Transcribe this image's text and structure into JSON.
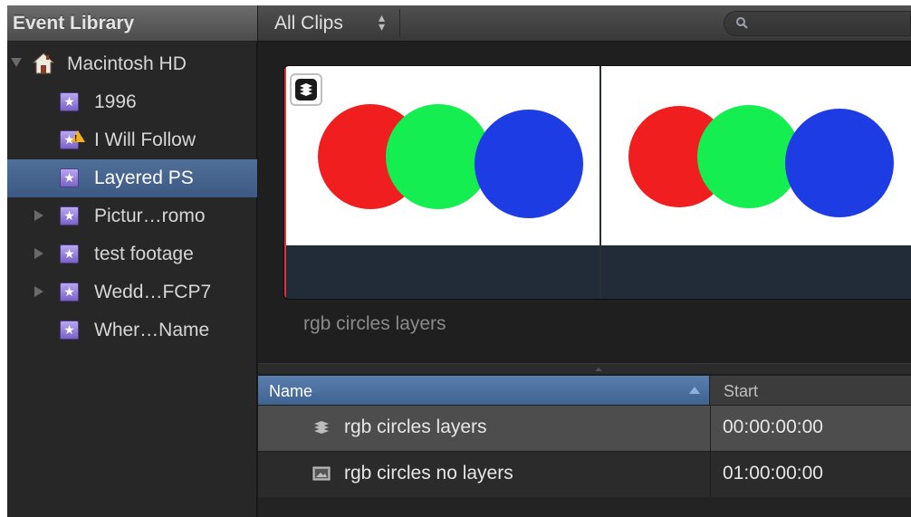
{
  "sidebar": {
    "title": "Event Library",
    "root": {
      "label": "Macintosh HD",
      "icon": "hard-drive-house-icon",
      "expanded": true
    },
    "events": [
      {
        "label": "1996",
        "icon": "event-star-icon",
        "has_children": false,
        "selected": false,
        "warning": false
      },
      {
        "label": "I Will Follow",
        "icon": "event-star-warning-icon",
        "has_children": false,
        "selected": false,
        "warning": true
      },
      {
        "label": "Layered PS",
        "icon": "event-star-icon",
        "has_children": false,
        "selected": true,
        "warning": false
      },
      {
        "label": "Pictur…romo",
        "icon": "event-star-icon",
        "has_children": true,
        "selected": false,
        "warning": false
      },
      {
        "label": "test footage",
        "icon": "event-star-icon",
        "has_children": true,
        "selected": false,
        "warning": false
      },
      {
        "label": "Wedd…FCP7",
        "icon": "event-star-icon",
        "has_children": true,
        "selected": false,
        "warning": false
      },
      {
        "label": "Wher…Name",
        "icon": "event-star-icon",
        "has_children": false,
        "selected": false,
        "warning": false
      }
    ]
  },
  "browser": {
    "filter": {
      "label": "All Clips",
      "icon": "up-down-arrows-icon"
    },
    "search": {
      "placeholder": "",
      "icon": "search-icon"
    },
    "filmstrip": {
      "caption": "rgb circles layers",
      "badge_icon": "layered-clip-icon",
      "circle_colors": {
        "red": "#f01e1e",
        "green": "#14ee50",
        "blue": "#1e3ce4"
      }
    },
    "list": {
      "columns": [
        "Name",
        "Start"
      ],
      "rows": [
        {
          "name": "rgb circles layers",
          "start": "00:00:00:00",
          "icon": "layered-clip-icon",
          "highlighted": true
        },
        {
          "name": "rgb circles no layers",
          "start": "01:00:00:00",
          "icon": "still-image-icon",
          "highlighted": false
        }
      ]
    }
  },
  "colors": {
    "selection": "#456791",
    "header_blue": "#4a6f9e",
    "background": "#1f1f1f"
  }
}
